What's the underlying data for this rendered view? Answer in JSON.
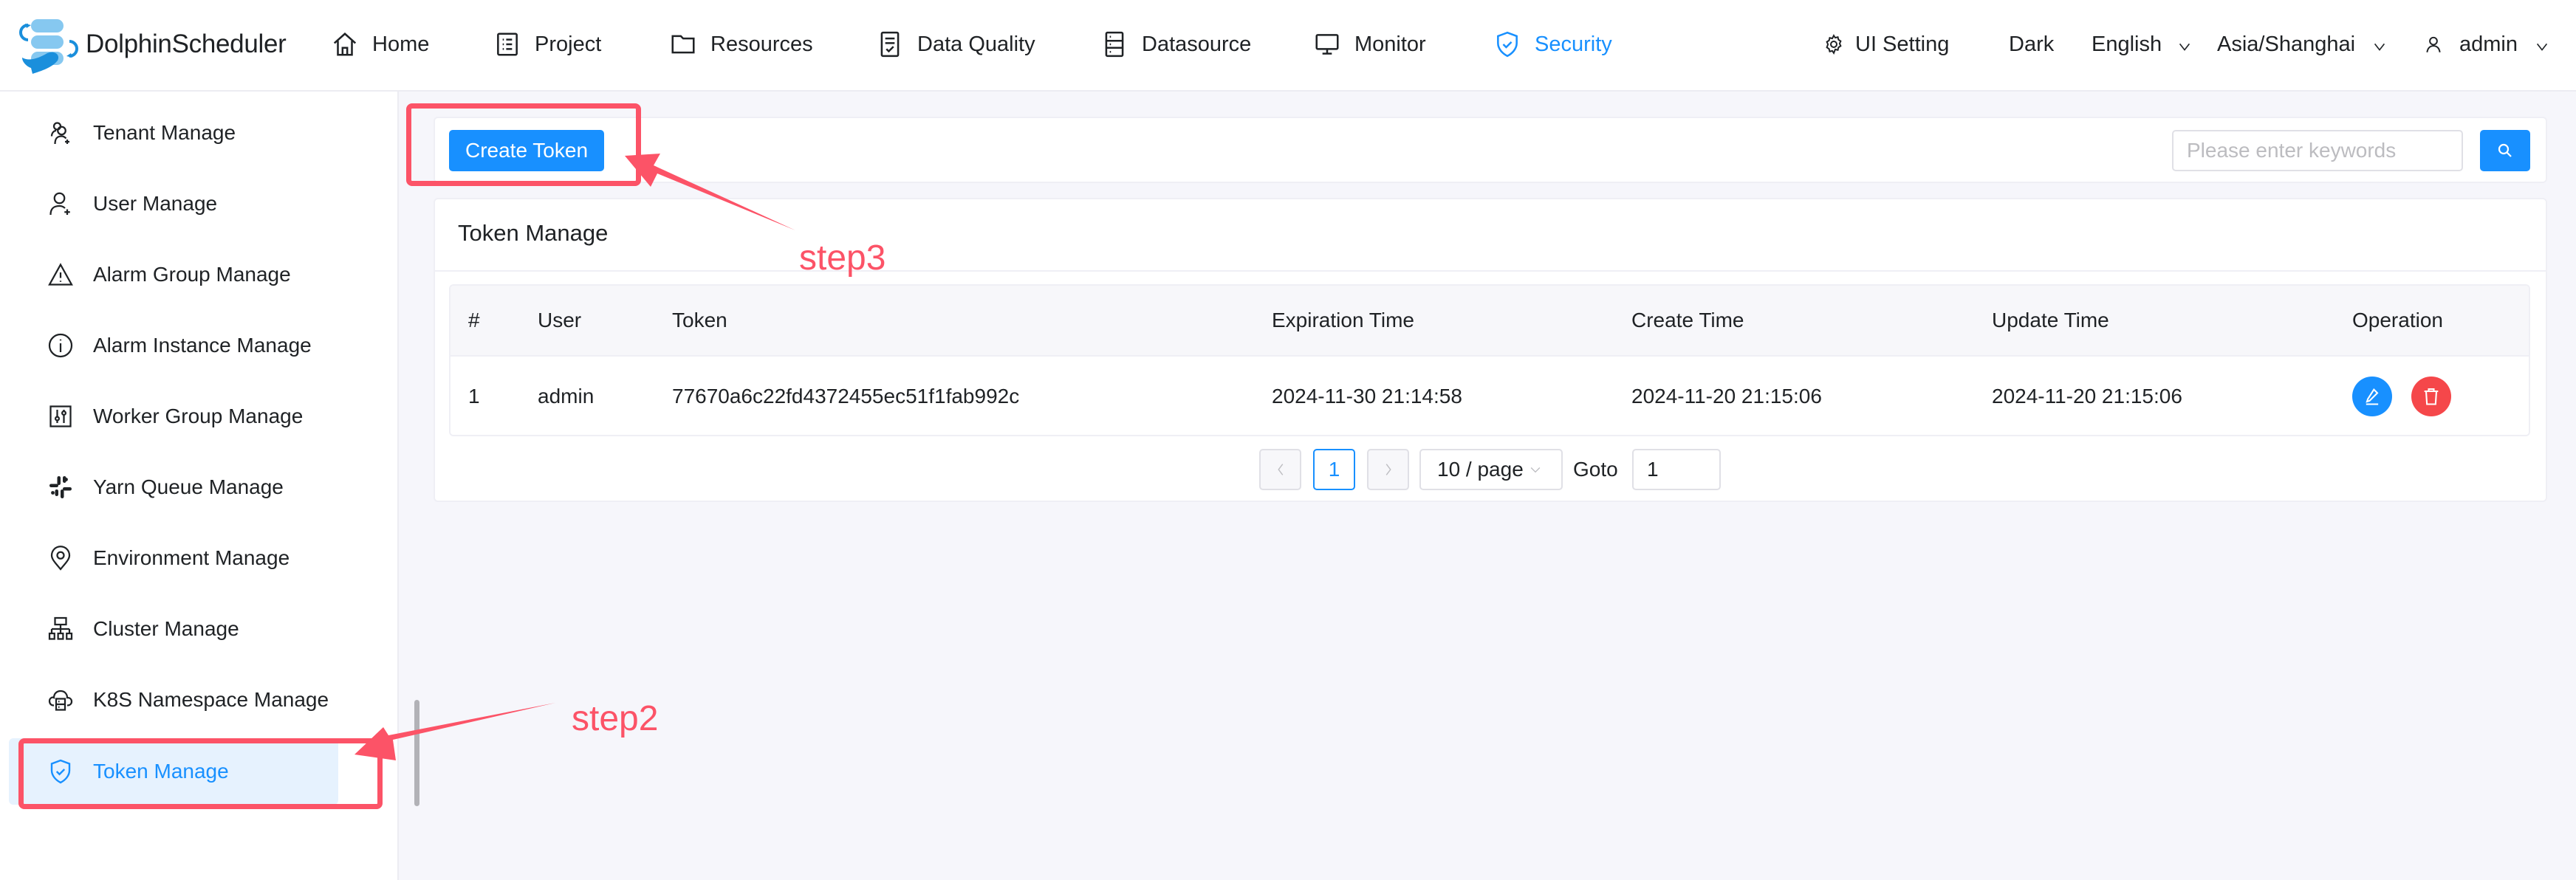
{
  "header": {
    "brand": "DolphinScheduler",
    "nav": [
      {
        "label": "Home",
        "icon": "home-icon"
      },
      {
        "label": "Project",
        "icon": "project-icon"
      },
      {
        "label": "Resources",
        "icon": "folder-icon"
      },
      {
        "label": "Data Quality",
        "icon": "data-quality-icon"
      },
      {
        "label": "Datasource",
        "icon": "datasource-icon"
      },
      {
        "label": "Monitor",
        "icon": "monitor-icon"
      },
      {
        "label": "Security",
        "icon": "shield-check-icon",
        "active": true
      }
    ],
    "ui_setting": "UI Setting",
    "theme": "Dark",
    "language": "English",
    "timezone": "Asia/Shanghai",
    "user": "admin"
  },
  "sidebar": {
    "items": [
      {
        "label": "Tenant Manage",
        "icon": "tenant-icon"
      },
      {
        "label": "User Manage",
        "icon": "user-add-icon"
      },
      {
        "label": "Alarm Group Manage",
        "icon": "warning-icon"
      },
      {
        "label": "Alarm Instance Manage",
        "icon": "info-icon"
      },
      {
        "label": "Worker Group Manage",
        "icon": "sliders-icon"
      },
      {
        "label": "Yarn Queue Manage",
        "icon": "slack-icon"
      },
      {
        "label": "Environment Manage",
        "icon": "location-icon"
      },
      {
        "label": "Cluster Manage",
        "icon": "cluster-icon"
      },
      {
        "label": "K8S Namespace Manage",
        "icon": "cloud-server-icon"
      },
      {
        "label": "Token Manage",
        "icon": "shield-check-icon",
        "active": true
      }
    ]
  },
  "toolbar": {
    "create_label": "Create Token",
    "search_placeholder": "Please enter keywords",
    "search_value": ""
  },
  "card": {
    "title": "Token Manage"
  },
  "table": {
    "columns": [
      "#",
      "User",
      "Token",
      "Expiration Time",
      "Create Time",
      "Update Time",
      "Operation"
    ],
    "rows": [
      {
        "index": "1",
        "user": "admin",
        "token": "77670a6c22fd4372455ec51f1fab992c",
        "expiration_time": "2024-11-30 21:14:58",
        "create_time": "2024-11-20 21:15:06",
        "update_time": "2024-11-20 21:15:06",
        "operations": [
          "edit",
          "delete"
        ]
      }
    ]
  },
  "pagination": {
    "current_page": "1",
    "page_size_label": "10 / page",
    "goto_label": "Goto",
    "goto_value": "1"
  },
  "annotations": {
    "step2": "step2",
    "step3": "step3",
    "color": "#fc5367"
  },
  "colors": {
    "primary": "#1890ff",
    "danger": "#f5474a",
    "active_bg": "#e6f2fe"
  }
}
